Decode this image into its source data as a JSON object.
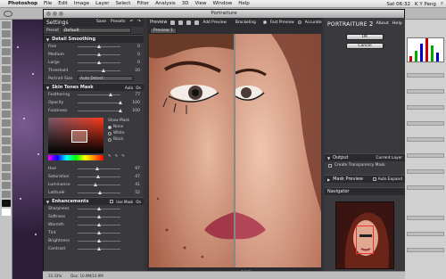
{
  "menubar": {
    "app": "Photoshop",
    "items": [
      "File",
      "Edit",
      "Image",
      "Layer",
      "Select",
      "Filter",
      "Analysis",
      "3D",
      "View",
      "Window",
      "Help"
    ],
    "clock": "Sat 06:32",
    "user": "K Y Pang"
  },
  "window": {
    "title": "Portraiture"
  },
  "settings": {
    "header": "Settings",
    "save": "Save",
    "presets": "Presets",
    "preset_label": "Preset",
    "preset_value": "Default",
    "detail_section": "Detail Smoothing",
    "detail_rows": [
      {
        "name": "Fine",
        "value": "0",
        "level": 0.5
      },
      {
        "name": "Medium",
        "value": "0",
        "level": 0.5
      },
      {
        "name": "Large",
        "value": "0",
        "level": 0.5
      },
      {
        "name": "Threshold",
        "value": "20",
        "level": 0.6
      }
    ],
    "portrait_size_label": "Portrait Size",
    "portrait_size_value": "Auto Detect",
    "tones_section": "Skin Tones Mask",
    "tones_auto": "Auto",
    "tones_on": "On",
    "tones_rows": [
      {
        "name": "Feathering",
        "value": "77",
        "level": 0.77
      },
      {
        "name": "Opacity",
        "value": "100",
        "level": 1.0
      },
      {
        "name": "Fuzziness",
        "value": "100",
        "level": 1.0
      }
    ],
    "show_mask_label": "Show Mask",
    "show_mask_options": [
      "None",
      "White",
      "Black"
    ],
    "hsl_rows": [
      {
        "name": "Hue",
        "value": "97",
        "level": 0.45
      },
      {
        "name": "Saturation",
        "value": "47",
        "level": 0.47
      },
      {
        "name": "Luminance",
        "value": "41",
        "level": 0.41
      },
      {
        "name": "Latitude",
        "value": "52",
        "level": 0.52
      }
    ],
    "enh_section": "Enhancements",
    "use_mask": "Use Mask",
    "enh_on": "On",
    "enh_rows": [
      {
        "name": "Sharpness",
        "level": 0.5
      },
      {
        "name": "Softness",
        "level": 0.5
      },
      {
        "name": "Warmth",
        "level": 0.5
      },
      {
        "name": "Tint",
        "level": 0.5
      },
      {
        "name": "Brightness",
        "level": 0.5
      },
      {
        "name": "Contrast",
        "level": 0.5
      }
    ]
  },
  "preview": {
    "header": "Preview",
    "add_preview": "Add Preview",
    "bracketing": "Bracketing",
    "fast_preview": "Fast Preview",
    "accurate": "Accurate",
    "tab": "Preview 1",
    "zoom": "100%"
  },
  "right_panel": {
    "brand": "PORTRAITURE",
    "version": "2",
    "about": "About",
    "help": "Help",
    "ok": "OK",
    "cancel": "Cancel",
    "output": "Output",
    "output_value": "Current Layer",
    "transparency": "Create Transparency Mask",
    "mask_preview": "Mask Preview",
    "auto_expand": "Auto Expand",
    "navigator": "Navigator"
  },
  "status": {
    "zoom": "33.33%",
    "doc": "Doc: 10.9M/10.9M"
  }
}
